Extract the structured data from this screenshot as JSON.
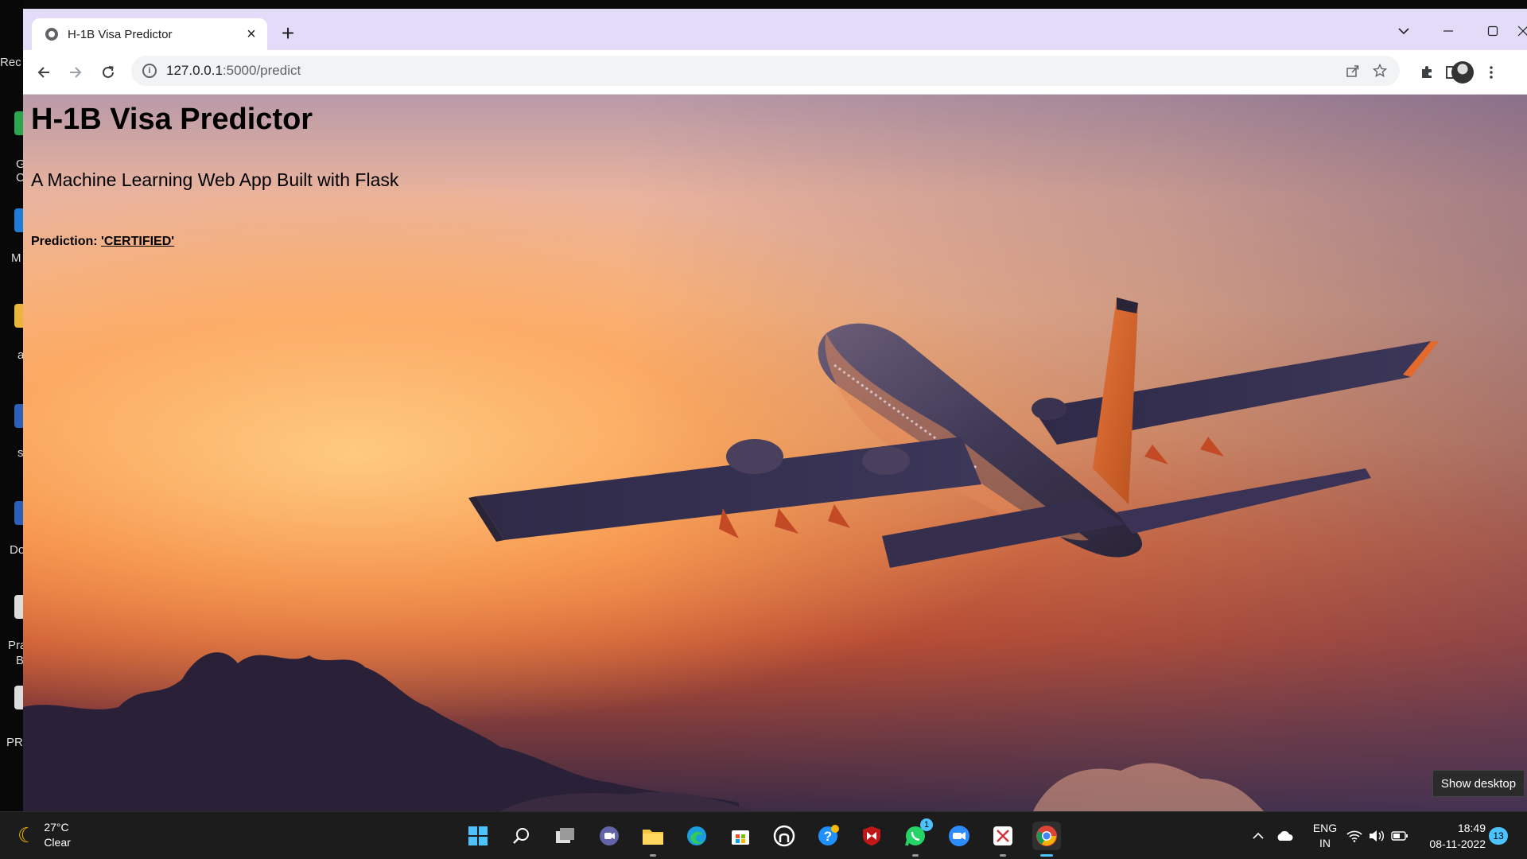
{
  "desktop": {
    "items": [
      {
        "label": "Rec"
      },
      {
        "label": "G"
      },
      {
        "label": "C"
      },
      {
        "label": "M"
      },
      {
        "label": "a"
      },
      {
        "label": "s"
      },
      {
        "label": "Do"
      },
      {
        "label": "Pra"
      },
      {
        "label": "B"
      },
      {
        "label": "PRA"
      }
    ]
  },
  "browser": {
    "tab_title": "H-1B Visa Predictor",
    "tab_close": "×",
    "new_tab": "+",
    "url_host": "127.0.0.1",
    "url_path": ":5000/predict",
    "info_glyph": "i"
  },
  "page": {
    "heading": "H-1B Visa Predictor",
    "subtitle": "A Machine Learning Web App Built with Flask",
    "prediction_label": "Prediction:",
    "prediction_value": "'CERTIFIED'"
  },
  "tooltip": {
    "show_desktop": "Show desktop"
  },
  "taskbar": {
    "weather_temp": "27°C",
    "weather_desc": "Clear",
    "lang_primary": "ENG",
    "lang_secondary": "IN",
    "time": "18:49",
    "date": "08-11-2022",
    "notifications": "13",
    "whatsapp_badge": "1",
    "apps": [
      "start",
      "search",
      "task-view",
      "teams",
      "file-explorer",
      "edge",
      "store",
      "github",
      "help",
      "mcafee",
      "whatsapp",
      "zoom",
      "snipping",
      "chrome"
    ]
  },
  "colors": {
    "tabbar_bg": "#e3dcf9",
    "taskbar_bg": "#1c1c1c",
    "accent": "#4cc2ff"
  }
}
